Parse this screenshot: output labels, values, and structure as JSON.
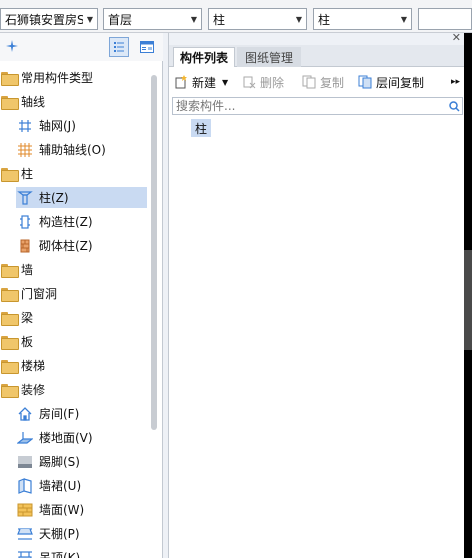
{
  "selectors": [
    {
      "value": "石狮镇安置房S..."
    },
    {
      "value": "首层"
    },
    {
      "value": "柱"
    },
    {
      "value": "柱"
    },
    {
      "value": ""
    }
  ],
  "tree": {
    "categories": [
      {
        "label": "常用构件类型"
      },
      {
        "label": "轴线",
        "children": [
          {
            "label": "轴网(J)"
          },
          {
            "label": "辅助轴线(O)"
          }
        ]
      },
      {
        "label": "柱",
        "children": [
          {
            "label": "柱(Z)"
          },
          {
            "label": "构造柱(Z)"
          },
          {
            "label": "砌体柱(Z)"
          }
        ]
      },
      {
        "label": "墙"
      },
      {
        "label": "门窗洞"
      },
      {
        "label": "梁"
      },
      {
        "label": "板"
      },
      {
        "label": "楼梯"
      },
      {
        "label": "装修",
        "children": [
          {
            "label": "房间(F)"
          },
          {
            "label": "楼地面(V)"
          },
          {
            "label": "踢脚(S)"
          },
          {
            "label": "墙裙(U)"
          },
          {
            "label": "墙面(W)"
          },
          {
            "label": "天棚(P)"
          },
          {
            "label": "吊顶(K)"
          }
        ]
      }
    ]
  },
  "tabs": {
    "list": "构件列表",
    "drawings": "图纸管理"
  },
  "actions": {
    "new": "新建",
    "delete": "删除",
    "copy": "复制",
    "floor_copy": "层间复制"
  },
  "search": {
    "placeholder": "搜索构件..."
  },
  "components": [
    "柱"
  ],
  "colors": {
    "selected_bg": "#c9daf2",
    "folder": "#f0c66a",
    "icon_blue": "#3b7fd6"
  }
}
